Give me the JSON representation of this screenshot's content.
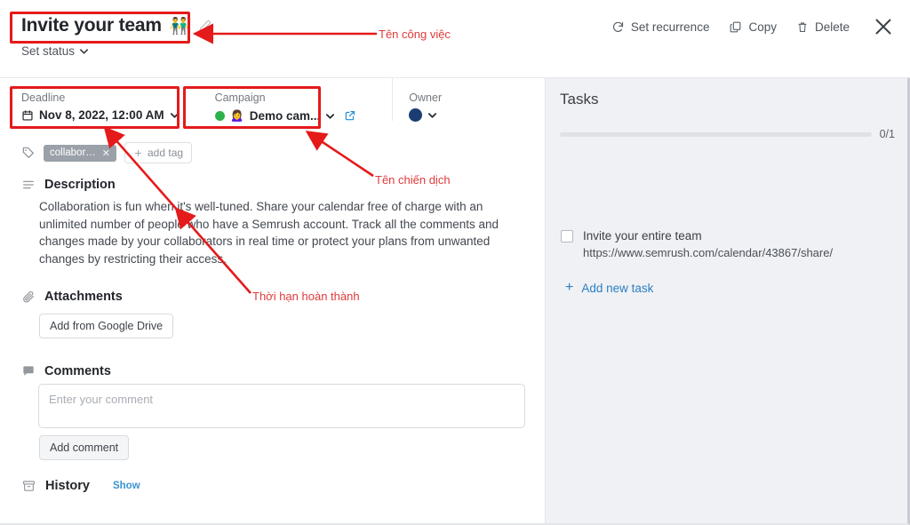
{
  "header": {
    "title": "Invite your team",
    "title_emoji": "👬",
    "edit_icon": "pencil-icon",
    "set_status_label": "Set status",
    "toolbar": {
      "set_recurrence_label": "Set recurrence",
      "copy_label": "Copy",
      "delete_label": "Delete",
      "close_label": "✕"
    }
  },
  "meta": {
    "deadline": {
      "label": "Deadline",
      "value": "Nov 8, 2022, 12:00 AM",
      "icon": "calendar-icon"
    },
    "campaign": {
      "label": "Campaign",
      "value": "Demo cam...",
      "emoji": "🙍‍♀️",
      "status_color": "#2bb24c",
      "external_link_icon": "external-link-icon"
    },
    "owner": {
      "label": "Owner",
      "avatar_color": "#1c3d73"
    }
  },
  "tags": {
    "chip_label": "collabora...",
    "chip_remove": "✕",
    "add_tag_label": "add tag"
  },
  "description": {
    "heading": "Description",
    "body": "Collaboration is fun when it's well-tuned. Share your calendar free of charge with an unlimited number of people who have a Semrush account. Track all the comments and changes made by your collaborators in real time or protect your plans from unwanted changes by restricting their access."
  },
  "attachments": {
    "heading": "Attachments",
    "add_button_label": "Add from Google Drive"
  },
  "comments": {
    "heading": "Comments",
    "placeholder": "Enter your comment",
    "value": "",
    "add_button_label": "Add comment"
  },
  "history": {
    "heading": "History",
    "show_label": "Show"
  },
  "tasks": {
    "title": "Tasks",
    "progress_label": "0/1",
    "progress_percent": 0,
    "items": [
      {
        "name": "Invite your entire team",
        "url": "https://www.semrush.com/calendar/43867/share/",
        "checked": false
      }
    ],
    "add_new_label": "Add new task"
  },
  "annotations": {
    "accent_color": "#e51a1a",
    "labels": [
      {
        "text": "Tên công việc"
      },
      {
        "text": "Tên chiến dịch"
      },
      {
        "text": "Thời hạn hoàn thành"
      }
    ]
  }
}
